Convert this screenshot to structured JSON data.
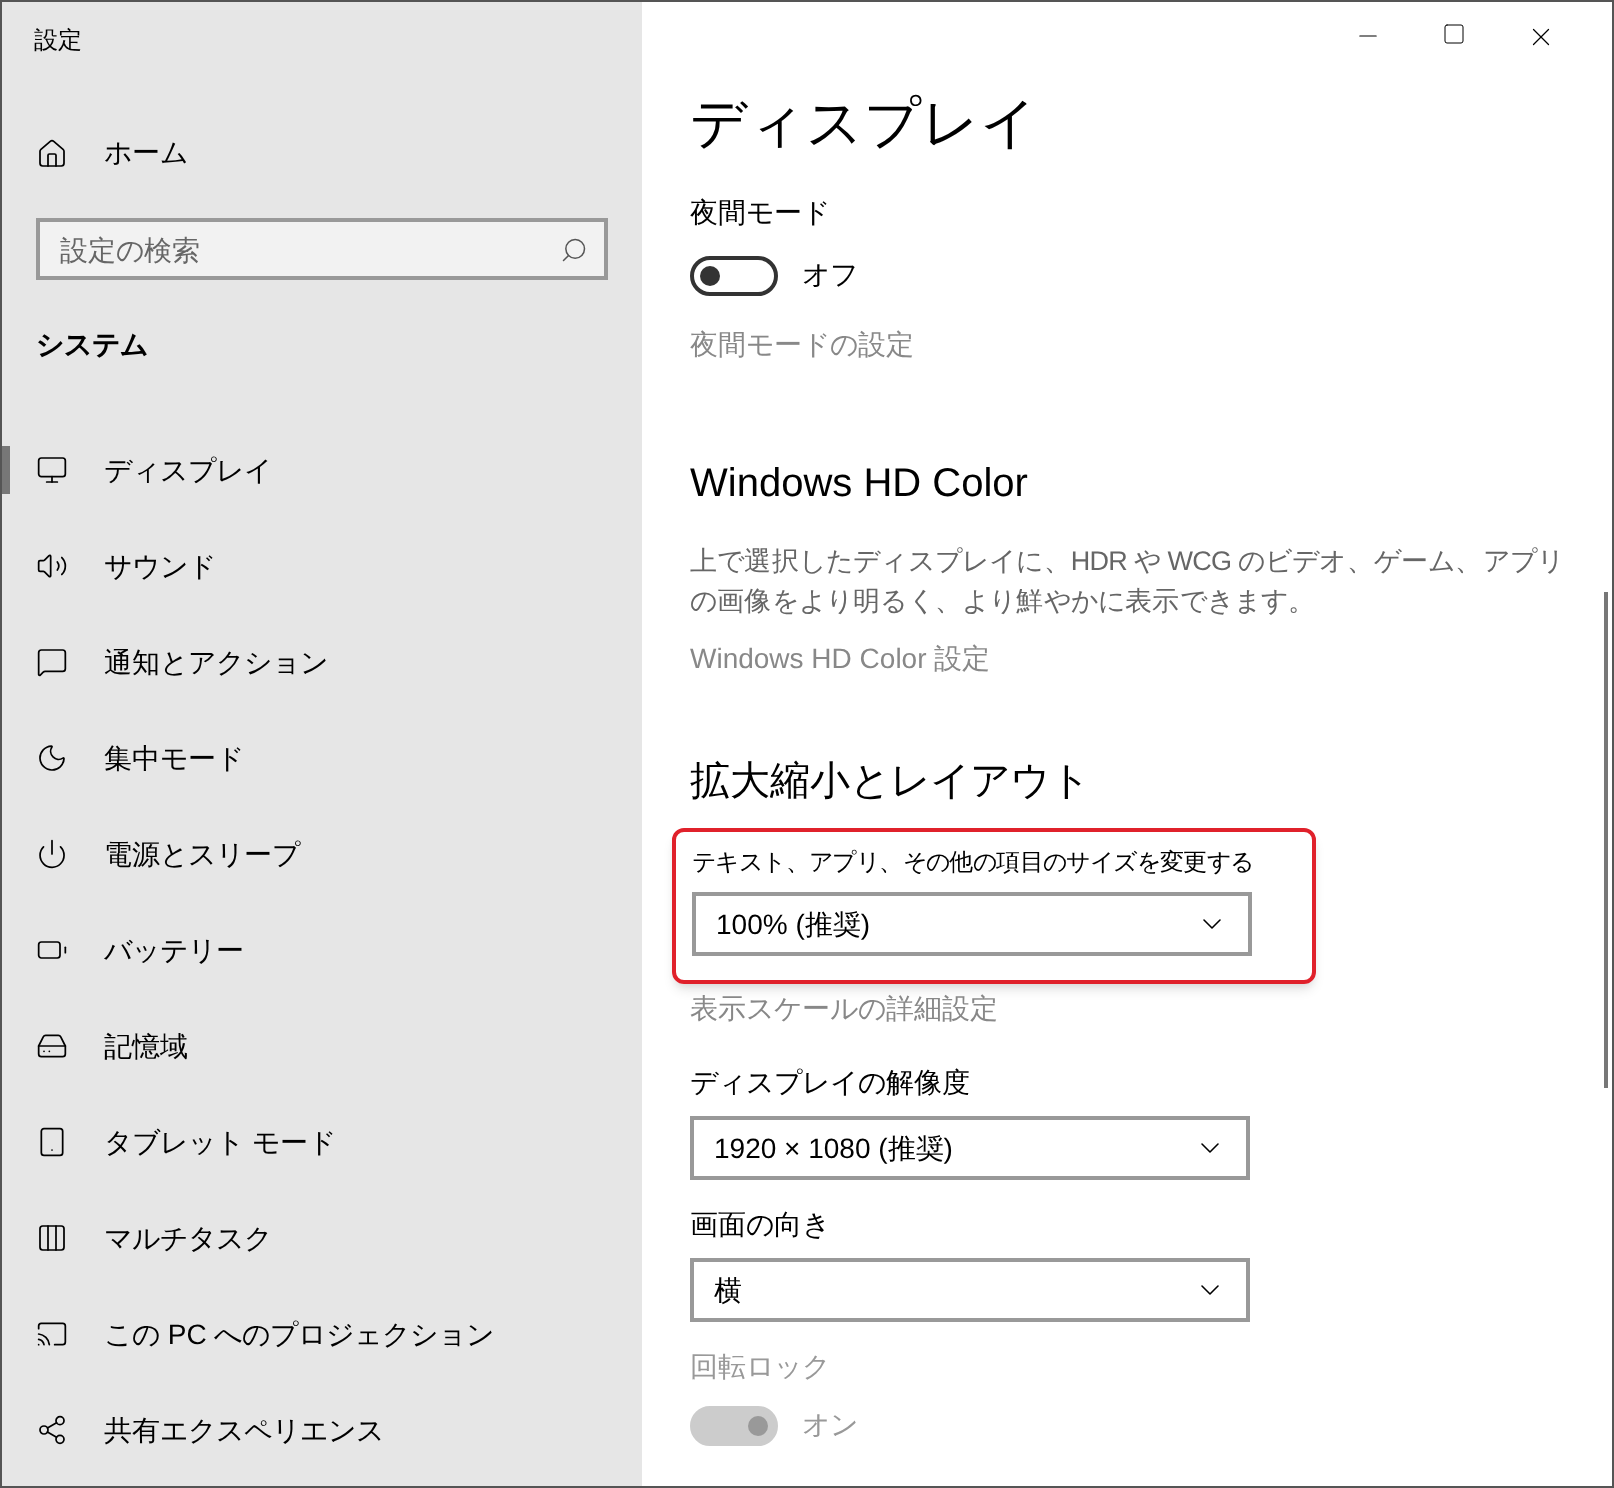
{
  "window": {
    "title": "設定"
  },
  "sidebar": {
    "home": "ホーム",
    "search": {
      "placeholder": "設定の検索"
    },
    "section": "システム",
    "items": [
      {
        "label": "ディスプレイ",
        "selected": true
      },
      {
        "label": "サウンド",
        "selected": false
      },
      {
        "label": "通知とアクション",
        "selected": false
      },
      {
        "label": "集中モード",
        "selected": false
      },
      {
        "label": "電源とスリープ",
        "selected": false
      },
      {
        "label": "バッテリー",
        "selected": false
      },
      {
        "label": "記憶域",
        "selected": false
      },
      {
        "label": "タブレット モード",
        "selected": false
      },
      {
        "label": "マルチタスク",
        "selected": false
      },
      {
        "label": "この PC へのプロジェクション",
        "selected": false
      },
      {
        "label": "共有エクスペリエンス",
        "selected": false
      }
    ]
  },
  "content": {
    "title": "ディスプレイ",
    "night_mode": {
      "label": "夜間モード",
      "toggle": {
        "on": false,
        "disabled": false,
        "text": "オフ"
      },
      "link": "夜間モードの設定"
    },
    "hd_color": {
      "heading": "Windows HD Color",
      "description": "上で選択したディスプレイに、HDR や WCG のビデオ、ゲーム、アプリの画像をより明るく、より鮮やかに表示できます。",
      "link": "Windows HD Color 設定"
    },
    "scale_layout": {
      "heading": "拡大縮小とレイアウト",
      "size": {
        "label": "テキスト、アプリ、その他の項目のサイズを変更する",
        "value": "100% (推奨)",
        "highlighted": true
      },
      "link": "表示スケールの詳細設定",
      "resolution": {
        "label": "ディスプレイの解像度",
        "value": "1920 × 1080 (推奨)"
      },
      "orientation": {
        "label": "画面の向き",
        "value": "横"
      },
      "rotation_lock": {
        "label": "回転ロック",
        "toggle": {
          "on": true,
          "disabled": true,
          "text": "オン"
        }
      }
    }
  }
}
